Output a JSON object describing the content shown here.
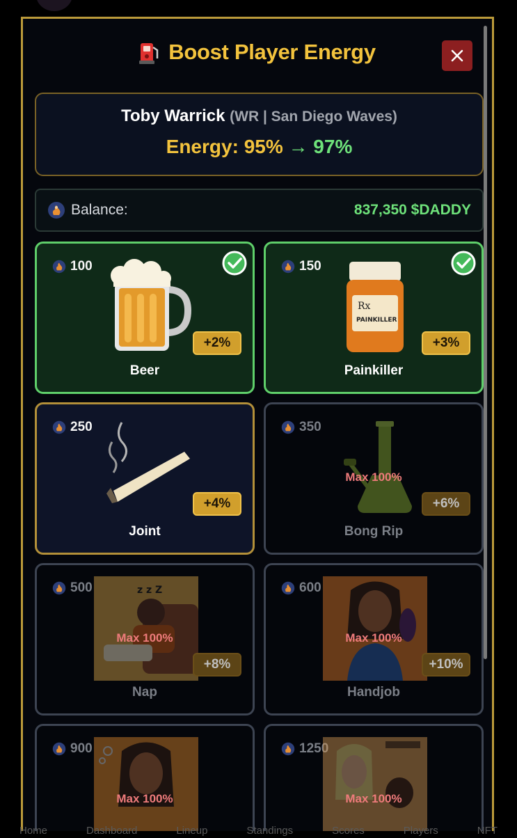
{
  "modal": {
    "title": "Boost Player Energy",
    "close_label": "✕",
    "title_icon": "fuel-pump-icon"
  },
  "player": {
    "name": "Toby Warrick",
    "position_team": "(WR | San Diego Waves)",
    "energy_label": "Energy:",
    "energy_current": "95%",
    "energy_arrow": "→",
    "energy_new": "97%"
  },
  "balance": {
    "label": "Balance:",
    "amount": "837,350 $DADDY",
    "icon": "daddy-token-icon"
  },
  "boosts": [
    {
      "cost": "100",
      "name": "Beer",
      "bonus": "+2%",
      "state": "selected",
      "max_text": ""
    },
    {
      "cost": "150",
      "name": "Painkiller",
      "bonus": "+3%",
      "state": "selected",
      "max_text": ""
    },
    {
      "cost": "250",
      "name": "Joint",
      "bonus": "+4%",
      "state": "available",
      "max_text": ""
    },
    {
      "cost": "350",
      "name": "Bong Rip",
      "bonus": "+6%",
      "state": "disabled",
      "max_text": "Max 100%"
    },
    {
      "cost": "500",
      "name": "Nap",
      "bonus": "+8%",
      "state": "disabled",
      "max_text": "Max 100%"
    },
    {
      "cost": "600",
      "name": "Handjob",
      "bonus": "+10%",
      "state": "disabled",
      "max_text": "Max 100%"
    },
    {
      "cost": "900",
      "name": "",
      "bonus": "",
      "state": "disabled",
      "max_text": "Max 100%"
    },
    {
      "cost": "1250",
      "name": "",
      "bonus": "",
      "state": "disabled",
      "max_text": "Max 100%"
    }
  ],
  "bottom_nav": [
    "Home",
    "Dashboard",
    "Lineup",
    "Standings",
    "Scores",
    "Players",
    "NFT"
  ],
  "colors": {
    "accent_gold": "#f3c33d",
    "energy_green": "#6ee27a",
    "close_red": "#8c1f20",
    "max_warning": "#ee7b7b"
  }
}
